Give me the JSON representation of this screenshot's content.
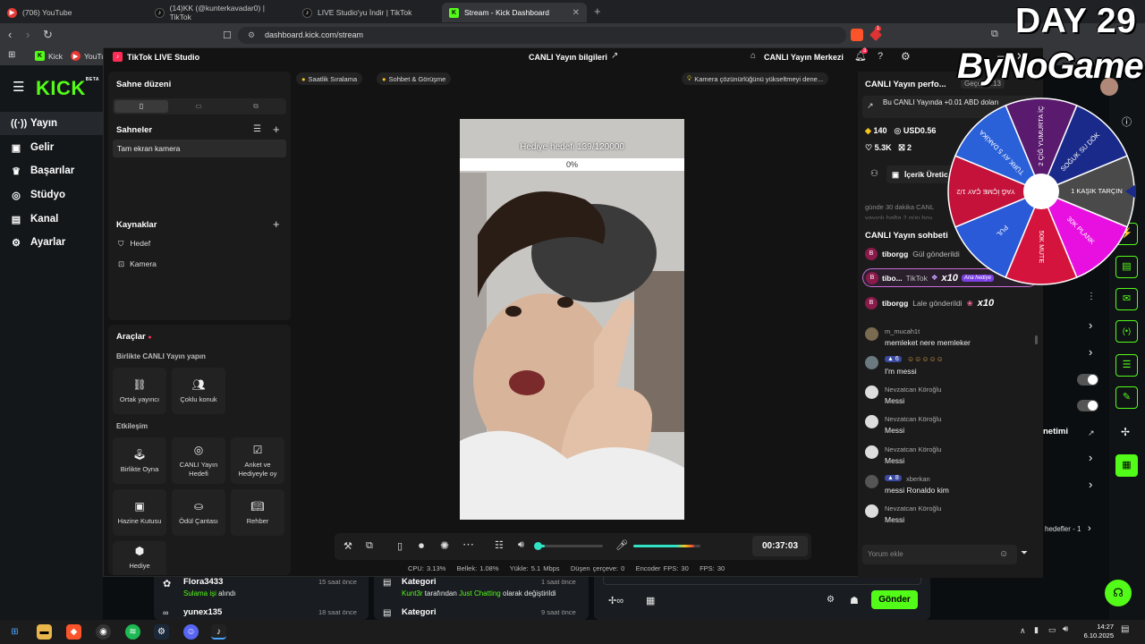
{
  "browser": {
    "tabs": [
      {
        "label": "(706) YouTube",
        "icon": "youtube-icon",
        "active": false
      },
      {
        "label": "(14)KK (@kunterkavadar0) | TikTok",
        "icon": "tiktok-icon",
        "active": false
      },
      {
        "label": "LIVE Studio'yu İndir | TikTok",
        "icon": "tiktok-icon",
        "active": false
      },
      {
        "label": "Stream - Kick Dashboard",
        "icon": "kick-icon",
        "active": true
      }
    ],
    "url": "dashboard.kick.com/stream",
    "bookmarks": [
      {
        "label": "Kick",
        "icon": "kick-icon"
      },
      {
        "label": "YouTu",
        "icon": "youtube-icon"
      }
    ],
    "extension_badge": "1"
  },
  "kick": {
    "logo": "KICK",
    "logo_sup": "BETA",
    "nav": [
      {
        "label": "Yayın",
        "icon": "broadcast-icon",
        "active": true
      },
      {
        "label": "Gelir",
        "icon": "income-icon",
        "active": false
      },
      {
        "label": "Başarılar",
        "icon": "trophy-icon",
        "active": false
      },
      {
        "label": "Stüdyo",
        "icon": "studio-icon",
        "active": false
      },
      {
        "label": "Kanal",
        "icon": "channel-icon",
        "active": false
      },
      {
        "label": "Ayarlar",
        "icon": "settings-icon",
        "active": false
      }
    ],
    "feed": [
      {
        "name": "Flora3433",
        "time": "15 saat önce",
        "action_green": "Sulama işi",
        "action_rest": " alındı"
      },
      {
        "name": "yunex135",
        "time": "18 saat önce"
      }
    ],
    "activity": [
      {
        "title": "Kategori",
        "time": "1 saat önce",
        "user": "Kunt3r",
        "mid": " tarafından ",
        "cat": "Just Chatting",
        "end": " olarak değiştirildi"
      },
      {
        "title": "Kategori",
        "time": "9 saat önce"
      }
    ],
    "send_button": "Gönder",
    "right_labels": {
      "management": "netimi",
      "goals": "hedefler - 1"
    }
  },
  "studio": {
    "title": "TikTok LIVE Studio",
    "center_title": "CANLI Yayın bilgileri",
    "live_center": "CANLI Yayın Merkezi",
    "notif_badge": "3",
    "scene_layout": "Sahne düzeni",
    "scenes_title": "Sahneler",
    "scene_item": "Tam ekran kamera",
    "sources_title": "Kaynaklar",
    "sources": [
      {
        "label": "Hedef",
        "icon": "shield-icon"
      },
      {
        "label": "Kamera",
        "icon": "camera-icon"
      }
    ],
    "tools_title": "Araçlar",
    "collab_title": "Birlikte CANLI Yayın yapın",
    "collab_tools": [
      {
        "label": "Ortak yayıncı",
        "icon": "link-icon"
      },
      {
        "label": "Çoklu konuk",
        "icon": "users-icon"
      }
    ],
    "engage_title": "Etkileşim",
    "engage_tools": [
      {
        "label": "Birlikte Oyna",
        "icon": "joystick-icon"
      },
      {
        "label": "CANLI Yayın Hedefi",
        "icon": "target-icon"
      },
      {
        "label": "Anket ve Hediyeyle oy",
        "icon": "poll-icon"
      },
      {
        "label": "Hazine Kutusu",
        "icon": "treasure-icon"
      },
      {
        "label": "Ödül Çantası",
        "icon": "bag-icon"
      },
      {
        "label": "Rehber",
        "icon": "book-icon"
      },
      {
        "label": "Hediye",
        "icon": "gift-icon"
      }
    ],
    "chips": [
      {
        "label": "Saatlik Sıralama",
        "icon": "medal-icon"
      },
      {
        "label": "Sohbet & Görüşme",
        "icon": "chat-icon"
      }
    ],
    "hint": "Kamera çözünürlüğünü yükseltmeyi dene...",
    "goal": {
      "label": "Hediye hedefi",
      "count": "139/120000",
      "progress": "0%"
    },
    "timer": "00:37:03",
    "stats": {
      "cpu_label": "CPU:",
      "cpu": "3.13%",
      "mem_label": "Bellek:",
      "mem": "1.08%",
      "upload_label": "Yükle:",
      "upload": "5.1 Mbps",
      "dropped_label": "Düşen çerçeve:",
      "dropped": "0",
      "enc_label": "Encoder FPS:",
      "enc": "30",
      "fps_label": "FPS:",
      "fps": "30"
    },
    "perf_title": "CANLI Yayın perfo...",
    "perf_tag": "Geçek",
    "perf_time": "4:13",
    "earn_text": "Bu CANLI Yayında +0.01 ABD doları",
    "stats_row": {
      "diamonds": "140",
      "usd": "USD0.56",
      "likes": "5.3K",
      "gifts": "2"
    },
    "creator_btn": "İçerik Üretic",
    "info_text": "günde 30 dakika CANL",
    "info_text2": "yayınlı hafta 2 gün boy",
    "chat_title": "CANLI Yayın sohbeti",
    "gift_lines": [
      {
        "user": "tiborgg",
        "text": "Gül gönderildi",
        "mult": "",
        "highlight": false
      },
      {
        "user": "tibo...",
        "text": "TikTok",
        "mult": "x10",
        "highlight": true,
        "badge": "Ana hediye"
      },
      {
        "user": "tiborgg",
        "text": "Lale gönderildi",
        "mult": "x10",
        "highlight": false
      }
    ],
    "chat": [
      {
        "user": "m_mucah1t",
        "msg": "memleket nere memleker",
        "level": ""
      },
      {
        "user": "",
        "msg": "I'm messi",
        "level": "6"
      },
      {
        "user": "Nevzatcan Köroğlu",
        "msg": "Messi",
        "level": ""
      },
      {
        "user": "Nevzatcan Köroğlu",
        "msg": "Messi",
        "level": ""
      },
      {
        "user": "Nevzatcan Köroğlu",
        "msg": "Messi",
        "level": ""
      },
      {
        "user": "xberkan",
        "msg": "messi Ronaldo kim",
        "level": "8"
      },
      {
        "user": "Nevzatcan Köroğlu",
        "msg": "Messi",
        "level": ""
      }
    ],
    "comment_placeholder": "Yorum ekle"
  },
  "overlay": {
    "day": "DAY 29",
    "brand": "ByNoGame",
    "wheel_segments": [
      {
        "label": "2 ÇİĞ YUMURTA İÇ",
        "color": "#5a1a6e"
      },
      {
        "label": "SOĞUK SU DÖK",
        "color": "#1a2a8a"
      },
      {
        "label": "1 KAŞIK TARÇIN",
        "color": "#4a4a4a"
      },
      {
        "label": "30K PLANK",
        "color": "#e810e0"
      },
      {
        "label": "50K MUTE",
        "color": "#d4143c"
      },
      {
        "label": "PUL",
        "color": "#2a5ad8"
      },
      {
        "label": "YAĞ İÇME ÇAY 1/2",
        "color": "#c4123a"
      },
      {
        "label": "TÜRK AY 5 DAKİKA",
        "color": "#2a60d8"
      }
    ]
  },
  "taskbar": {
    "time": "14:27",
    "date": "6.10.2025"
  }
}
